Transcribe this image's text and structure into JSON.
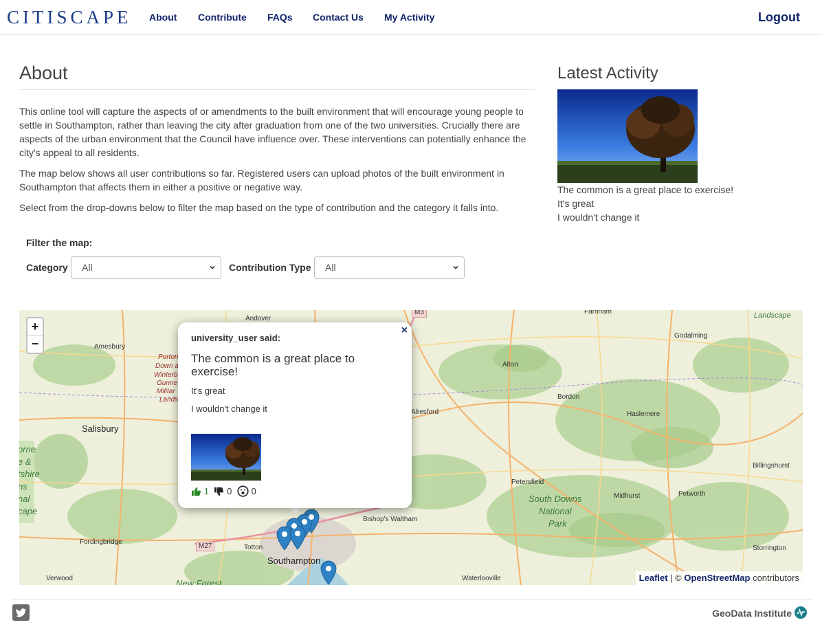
{
  "nav": {
    "brand": "CITISCAPE",
    "links": [
      "About",
      "Contribute",
      "FAQs",
      "Contact Us",
      "My Activity"
    ],
    "logout": "Logout"
  },
  "about": {
    "title": "About",
    "paragraphs": [
      "This online tool will capture the aspects of or amendments to the built environment that will encourage young people to settle in Southampton, rather than leaving the city after graduation from one of the two universities. Crucially there are aspects of the urban environment that the Council have influence over. These interventions can potentially enhance the city's appeal to all residents.",
      "The map below shows all user contributions so far. Registered users can upload photos of the built environment in Southampton that affects them in either a positive or negative way.",
      "Select from the drop-downs below to filter the map based on the type of contribution and the category it falls into."
    ]
  },
  "filter": {
    "title": "Filter the map:",
    "category_label": "Category",
    "category_value": "All",
    "type_label": "Contribution Type",
    "type_value": "All"
  },
  "latest": {
    "title": "Latest Activity",
    "lines": [
      "The common is a great place to exercise!",
      "It's great",
      "I wouldn't change it"
    ]
  },
  "map": {
    "zoom_in": "+",
    "zoom_out": "−",
    "places": [
      "Andover",
      "Farnham",
      "Amesbury",
      "Godalming",
      "Alton",
      "Bordon",
      "Salisbury",
      "Alresford",
      "Haslemere",
      "Billingshurst",
      "Petersfield",
      "Midhurst",
      "Petworth",
      "Bishop's Waltham",
      "Fordingbridge",
      "Totton",
      "Southampton",
      "Storrington",
      "Verwood",
      "Waterlooville",
      "M27",
      "M3"
    ],
    "parks": [
      "South Downs",
      "National",
      "Park",
      "Landscape"
    ],
    "left_edge_labels": [
      "Porton",
      "Down an",
      "Winterbou",
      "Gunne",
      "Militar",
      "Lands"
    ],
    "left_edge_green": [
      "orne",
      "e &",
      "tshire",
      "ns",
      "nal",
      "cape"
    ],
    "new_forest": "New Forest",
    "attribution_leaflet": "Leaflet",
    "attribution_sep": " | © ",
    "attribution_osm": "OpenStreetMap",
    "attribution_rest": " contributors"
  },
  "popup": {
    "close": "×",
    "author": "university_user said:",
    "headline": "The common is a great place to exercise!",
    "line1": "It's great",
    "line2": "I wouldn't change it",
    "likes": "1",
    "dislikes": "0",
    "surprised": "0",
    "colors": {
      "like": "#2a8a2a",
      "pin": "#2e81c5"
    }
  },
  "footer": {
    "brand": "GeoData Institute"
  }
}
